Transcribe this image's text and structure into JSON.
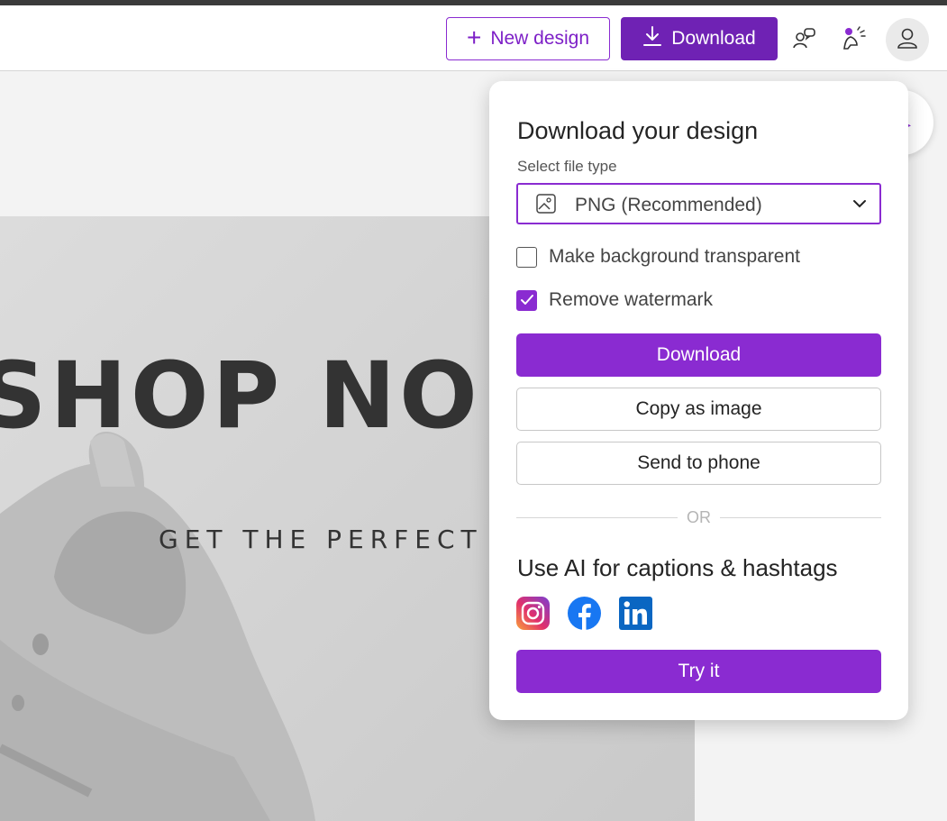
{
  "header": {
    "new_design_label": "New design",
    "download_label": "Download",
    "icons": [
      "plus-icon",
      "download-icon",
      "people-chat-icon",
      "celebrate-icon",
      "user-avatar-icon"
    ]
  },
  "design": {
    "headline": "SHOP NO",
    "subline": "GET THE PERFECT S"
  },
  "download_panel": {
    "title": "Download your design",
    "file_type_label": "Select file type",
    "file_type_value": "PNG (Recommended)",
    "options": {
      "transparent_label": "Make background transparent",
      "transparent_checked": false,
      "watermark_label": "Remove watermark",
      "watermark_checked": true
    },
    "download_button": "Download",
    "copy_button": "Copy as image",
    "send_button": "Send to phone",
    "separator": "OR",
    "ai_title": "Use AI for captions & hashtags",
    "socials": [
      "instagram-icon",
      "facebook-icon",
      "linkedin-icon"
    ],
    "try_button": "Try it"
  },
  "colors": {
    "accent": "#8a2bd1",
    "accent_dark": "#6f22b4",
    "header_bg": "#ffffff",
    "canvas_bg": "#f3f3f3"
  }
}
